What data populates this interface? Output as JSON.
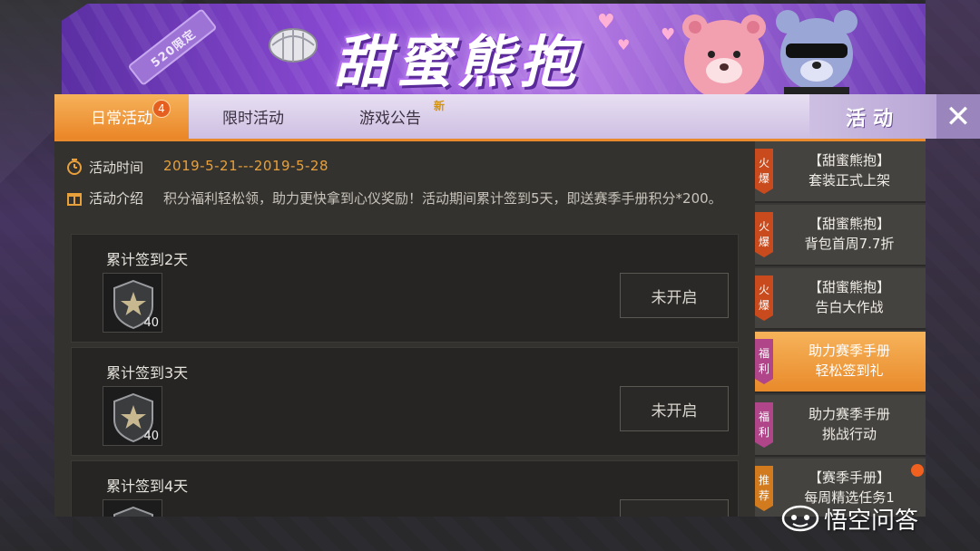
{
  "banner": {
    "badge": "520限定",
    "title": "甜蜜熊抱"
  },
  "tabs": [
    {
      "label": "日常活动",
      "badge": "4"
    },
    {
      "label": "限时活动"
    },
    {
      "label": "游戏公告",
      "tag": "新"
    }
  ],
  "section_title": "活动",
  "close_label": "✕",
  "info": {
    "time_label": "活动时间",
    "time_value": "2019-5-21---2019-5-28",
    "intro_label": "活动介绍",
    "intro_value": "积分福利轻松领，助力更快拿到心仪奖励！活动期间累计签到5天，即送赛季手册积分*200。"
  },
  "tasks": [
    {
      "title": "累计签到2天",
      "reward_count": "40",
      "status": "未开启"
    },
    {
      "title": "累计签到3天",
      "reward_count": "40",
      "status": "未开启"
    },
    {
      "title": "累计签到4天"
    }
  ],
  "side_items": [
    {
      "tag": [
        "火",
        "爆"
      ],
      "line1": "【甜蜜熊抱】",
      "line2": "套装正式上架"
    },
    {
      "tag": [
        "火",
        "爆"
      ],
      "line1": "【甜蜜熊抱】",
      "line2": "背包首周7.7折"
    },
    {
      "tag": [
        "火",
        "爆"
      ],
      "line1": "【甜蜜熊抱】",
      "line2": "告白大作战"
    },
    {
      "tag": [
        "福",
        "利"
      ],
      "line1": "助力赛季手册",
      "line2": "轻松签到礼"
    },
    {
      "tag": [
        "福",
        "利"
      ],
      "line1": "助力赛季手册",
      "line2": "挑战行动"
    },
    {
      "tag": [
        "推",
        "荐"
      ],
      "line1": "【赛季手册】",
      "line2": "每周精选任务1"
    }
  ],
  "watermark": "悟空问答",
  "colors": {
    "accent_orange": "#ea8628",
    "date_orange": "#e8a03a",
    "banner_purple": "#8d4bd6"
  }
}
